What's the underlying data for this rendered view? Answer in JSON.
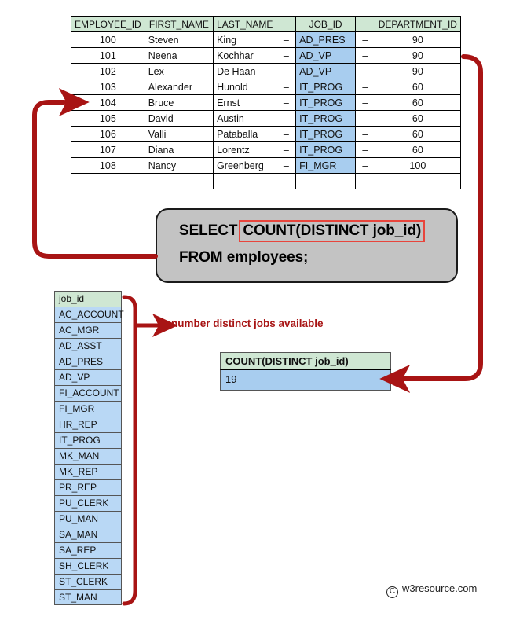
{
  "employees_table": {
    "name": "employees",
    "columns": [
      "EMPLOYEE_ID",
      "FIRST_NAME",
      "LAST_NAME",
      "",
      "JOB_ID",
      "",
      "DEPARTMENT_ID"
    ],
    "rows": [
      {
        "employee_id": "100",
        "first_name": "Steven",
        "last_name": "King",
        "gap1": "–",
        "job_id": "AD_PRES",
        "gap2": "–",
        "department_id": "90"
      },
      {
        "employee_id": "101",
        "first_name": "Neena",
        "last_name": "Kochhar",
        "gap1": "–",
        "job_id": "AD_VP",
        "gap2": "–",
        "department_id": "90"
      },
      {
        "employee_id": "102",
        "first_name": "Lex",
        "last_name": "De Haan",
        "gap1": "–",
        "job_id": "AD_VP",
        "gap2": "–",
        "department_id": "90"
      },
      {
        "employee_id": "103",
        "first_name": "Alexander",
        "last_name": "Hunold",
        "gap1": "–",
        "job_id": "IT_PROG",
        "gap2": "–",
        "department_id": "60"
      },
      {
        "employee_id": "104",
        "first_name": "Bruce",
        "last_name": "Ernst",
        "gap1": "–",
        "job_id": "IT_PROG",
        "gap2": "–",
        "department_id": "60"
      },
      {
        "employee_id": "105",
        "first_name": "David",
        "last_name": "Austin",
        "gap1": "–",
        "job_id": "IT_PROG",
        "gap2": "–",
        "department_id": "60"
      },
      {
        "employee_id": "106",
        "first_name": "Valli",
        "last_name": "Pataballa",
        "gap1": "–",
        "job_id": "IT_PROG",
        "gap2": "–",
        "department_id": "60"
      },
      {
        "employee_id": "107",
        "first_name": "Diana",
        "last_name": "Lorentz",
        "gap1": "–",
        "job_id": "IT_PROG",
        "gap2": "–",
        "department_id": "60"
      },
      {
        "employee_id": "108",
        "first_name": "Nancy",
        "last_name": "Greenberg",
        "gap1": "–",
        "job_id": "FI_MGR",
        "gap2": "–",
        "department_id": "100"
      },
      {
        "employee_id": "–",
        "first_name": "–",
        "last_name": "–",
        "gap1": "–",
        "job_id": "–",
        "gap2": "–",
        "department_id": "–"
      }
    ]
  },
  "sql": {
    "keyword_prefix": "SELECT",
    "highlighted_expression": "COUNT(DISTINCT job_id)",
    "line2": "FROM employees;"
  },
  "job_list": {
    "header": "job_id",
    "values": [
      "AC_ACCOUNT",
      "AC_MGR",
      "AD_ASST",
      "AD_PRES",
      "AD_VP",
      "FI_ACCOUNT",
      "FI_MGR",
      "HR_REP",
      "IT_PROG",
      "MK_MAN",
      "MK_REP",
      "PR_REP",
      "PU_CLERK",
      "PU_MAN",
      "SA_MAN",
      "SA_REP",
      "SH_CLERK",
      "ST_CLERK",
      "ST_MAN"
    ]
  },
  "result": {
    "header": "COUNT(DISTINCT job_id)",
    "value": "19"
  },
  "annotation": {
    "text": "number distinct jobs available"
  },
  "footer": {
    "copyright_symbol": "C",
    "site": "w3resource.com"
  },
  "colors": {
    "header_green": "#cfe7d3",
    "highlight_blue": "#a8cdef",
    "list_blue": "#b9d8f5",
    "arrow_red": "#a81414",
    "keyword_box_red": "#e8453c",
    "sql_box_gray": "#c3c3c3"
  }
}
